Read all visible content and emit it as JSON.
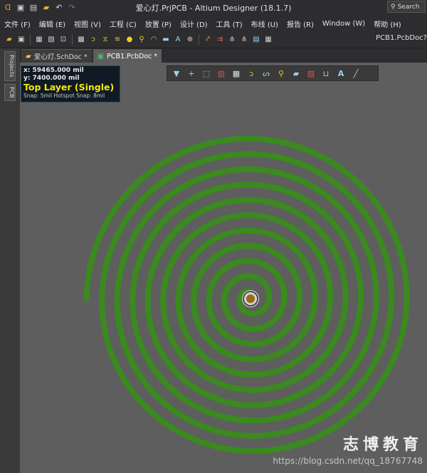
{
  "window": {
    "title": "爱心灯.PrjPCB - Altium Designer (18.1.7)",
    "search_label": "Search"
  },
  "menu": [
    "文件 (F)",
    "编辑 (E)",
    "视图 (V)",
    "工程 (C)",
    "放置 (P)",
    "设计 (D)",
    "工具 (T)",
    "布线 (U)",
    "报告 (R)",
    "Window (W)",
    "帮助 (H)"
  ],
  "toolbar": {
    "pcb_doc_combo": "PCB1.PcbDoc?"
  },
  "side_tabs": [
    "Projects",
    "PCB"
  ],
  "doc_tabs": [
    {
      "label": "爱心灯.SchDoc *",
      "active": false
    },
    {
      "label": "PCB1.PcbDoc *",
      "active": true
    }
  ],
  "hud": {
    "x": "x: 59465.000  mil",
    "y": "y:  7400.000  mil",
    "layer": "Top Layer (Single)",
    "snap": "Snap: 5mil Hotspot Snap: 8mil"
  },
  "colors": {
    "trace": "#3a8a1e",
    "pad_ring": "#d0d0d0",
    "pad_hole": "#9a6a12",
    "layer_text": "#f6e800"
  },
  "watermark": {
    "text": "志博教育",
    "url": "https://blog.csdn.net/qq_18767748"
  }
}
